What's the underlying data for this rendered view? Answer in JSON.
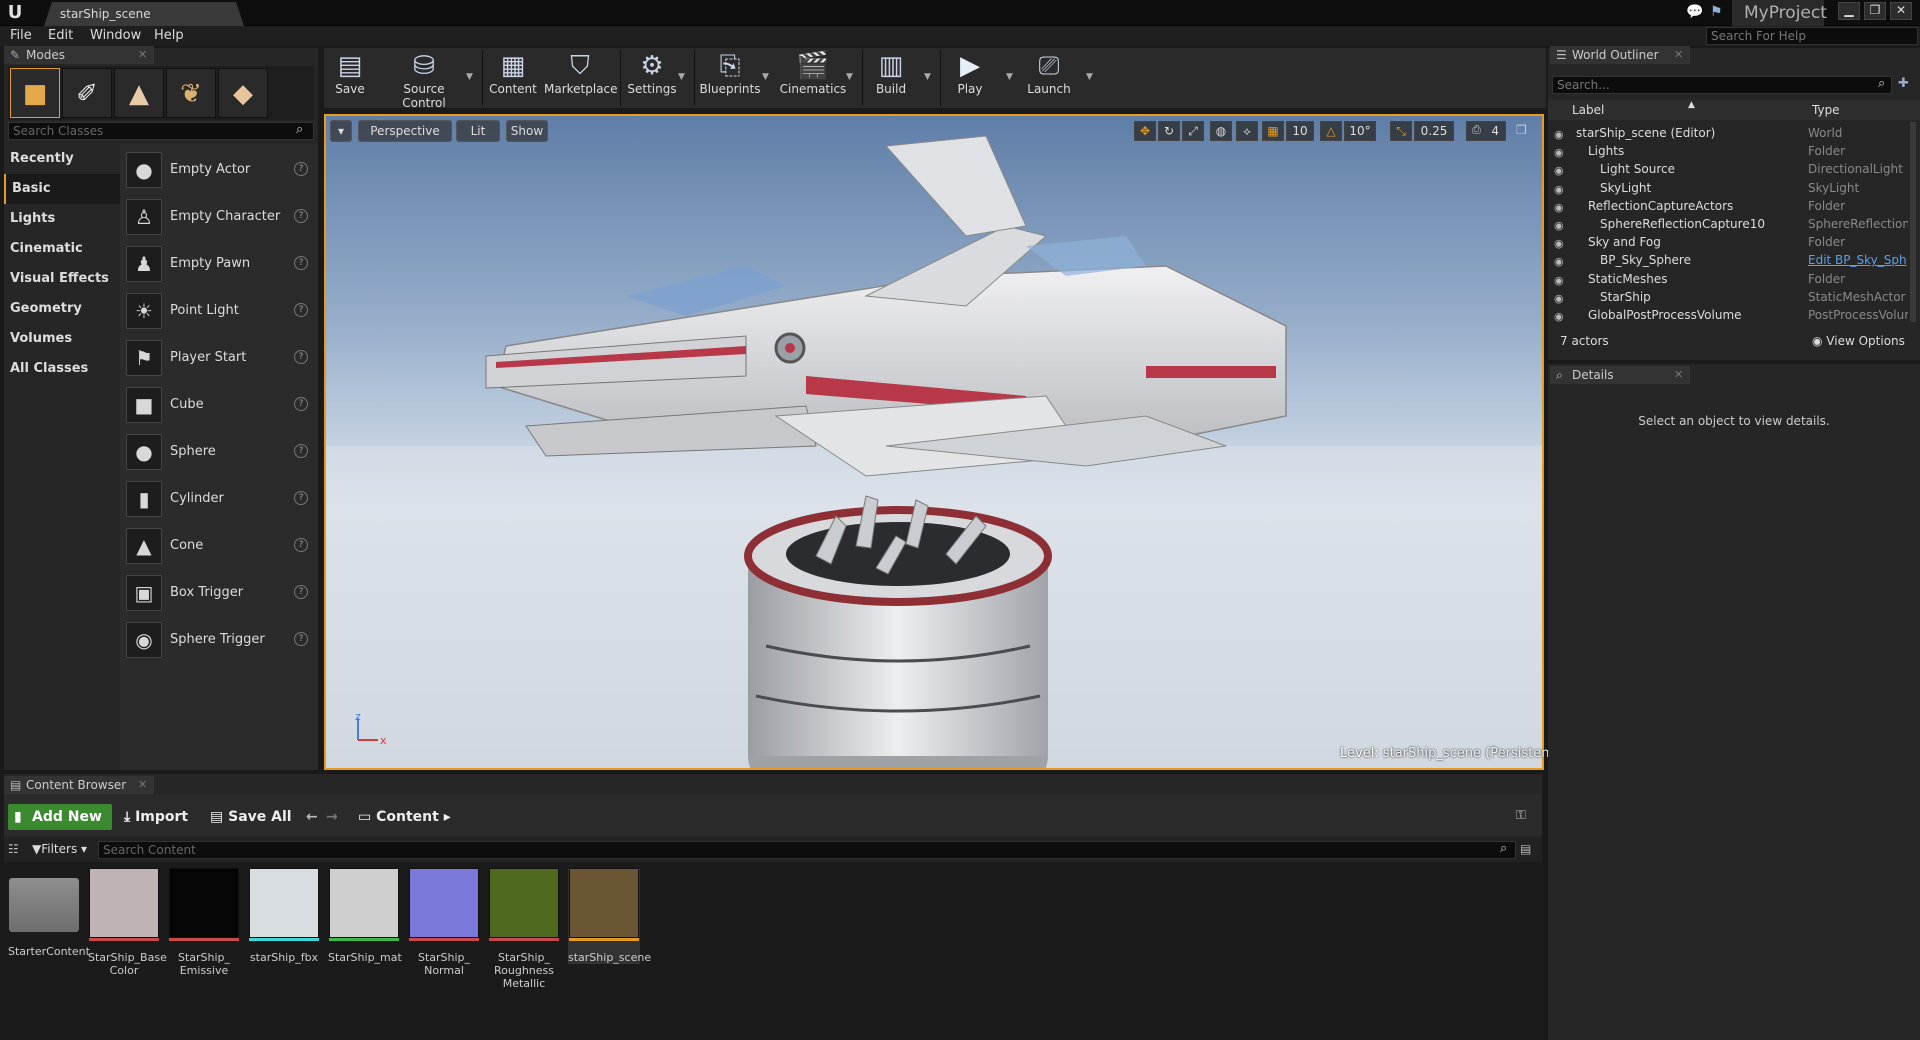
{
  "window": {
    "doc_tab": "starShip_scene",
    "project": "MyProject",
    "menu": [
      "File",
      "Edit",
      "Window",
      "Help"
    ],
    "help_search_placeholder": "Search For Help"
  },
  "modes": {
    "tab_label": "Modes",
    "search_placeholder": "Search Classes",
    "categories": [
      "Recently Placed",
      "Basic",
      "Lights",
      "Cinematic",
      "Visual Effects",
      "Geometry",
      "Volumes",
      "All Classes"
    ],
    "selected_category": "Basic",
    "classes": [
      "Empty Actor",
      "Empty Character",
      "Empty Pawn",
      "Point Light",
      "Player Start",
      "Cube",
      "Sphere",
      "Cylinder",
      "Cone",
      "Box Trigger",
      "Sphere Trigger"
    ]
  },
  "toolbar": {
    "items": [
      "Save",
      "Source Control",
      "Content",
      "Marketplace",
      "Settings",
      "Blueprints",
      "Cinematics",
      "Build",
      "Play",
      "Launch"
    ]
  },
  "viewport": {
    "perspective": "Perspective",
    "lit": "Lit",
    "show": "Show",
    "grid_snap": "10",
    "rotation_snap": "10°",
    "scale_snap": "0.25",
    "camera_speed": "4",
    "level_prefix": "Level:",
    "level_name": "starShip_scene (Persistent)",
    "axis_x": "x",
    "axis_z": "z"
  },
  "outliner": {
    "tab_label": "World Outliner",
    "search_placeholder": "Search...",
    "col_label": "Label",
    "col_type": "Type",
    "rows": [
      {
        "label": "starShip_scene (Editor)",
        "type": "World",
        "indent": 0
      },
      {
        "label": "Lights",
        "type": "Folder",
        "indent": 1
      },
      {
        "label": "Light Source",
        "type": "DirectionalLight",
        "indent": 2
      },
      {
        "label": "SkyLight",
        "type": "SkyLight",
        "indent": 2
      },
      {
        "label": "ReflectionCaptureActors",
        "type": "Folder",
        "indent": 1
      },
      {
        "label": "SphereReflectionCapture10",
        "type": "SphereReflectionC",
        "indent": 2
      },
      {
        "label": "Sky and Fog",
        "type": "Folder",
        "indent": 1
      },
      {
        "label": "BP_Sky_Sphere",
        "type": "Edit BP_Sky_Sph",
        "indent": 2
      },
      {
        "label": "StaticMeshes",
        "type": "Folder",
        "indent": 1
      },
      {
        "label": "StarShip",
        "type": "StaticMeshActor",
        "indent": 2
      },
      {
        "label": "GlobalPostProcessVolume",
        "type": "PostProcessVolur",
        "indent": 1
      }
    ],
    "actor_count": "7 actors",
    "view_options": "View Options"
  },
  "details": {
    "tab_label": "Details",
    "empty_message": "Select an object to view details."
  },
  "content_browser": {
    "tab_label": "Content Browser",
    "add_new": "Add New",
    "import": "Import",
    "save_all": "Save All",
    "path_root": "Content",
    "filters": "Filters",
    "search_placeholder": "Search Content",
    "assets": [
      {
        "name": "StarterContent",
        "thumb": "#8a8a8a",
        "bar": "transparent"
      },
      {
        "name": "StarShip_Base Color",
        "thumb": "#bfb3b3",
        "bar": "#c84a4a"
      },
      {
        "name": "StarShip_ Emissive",
        "thumb": "#050505",
        "bar": "#c84a4a"
      },
      {
        "name": "starShip_fbx",
        "thumb": "#d8dde2",
        "bar": "#3fd6d6"
      },
      {
        "name": "StarShip_mat",
        "thumb": "#cfcfcf",
        "bar": "#3fb84a"
      },
      {
        "name": "StarShip_ Normal",
        "thumb": "#7a78d8",
        "bar": "#c84a4a"
      },
      {
        "name": "StarShip_ Roughness Metallic",
        "thumb": "#4f6a1e",
        "bar": "#c84a4a"
      },
      {
        "name": "starShip_scene",
        "thumb": "#6b5634",
        "bar": "#e39c1f"
      }
    ]
  }
}
